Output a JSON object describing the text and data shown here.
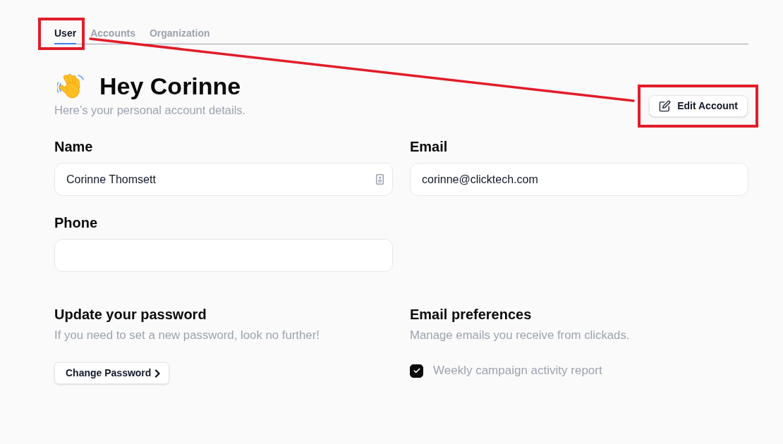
{
  "tabs": [
    {
      "label": "User",
      "selected": true,
      "highlighted": true
    },
    {
      "label": "Accounts",
      "selected": false,
      "highlighted": false
    },
    {
      "label": "Organization",
      "selected": false,
      "highlighted": false
    }
  ],
  "header": {
    "greeting": "Hey Corinne",
    "subtitle": "Here’s your personal account details.",
    "edit_button": {
      "label": "Edit Account",
      "highlighted": true
    }
  },
  "fields": [
    {
      "label": "Name",
      "value": "Corinne Thomsett",
      "kind": "autofill"
    },
    {
      "label": "Email",
      "value": "corinne@clicktech.com",
      "kind": "text"
    },
    {
      "label": "Phone",
      "kind": "text"
    }
  ],
  "password": {
    "title": "Update your password",
    "description": "If you need to set a new password, look no further!",
    "button": "Change Password"
  },
  "email_preferences": {
    "title": "Email preferences",
    "description": "Manage emails you receive from clickads.",
    "options": [
      {
        "label": "Weekly campaign activity report",
        "checked": true
      }
    ]
  }
}
